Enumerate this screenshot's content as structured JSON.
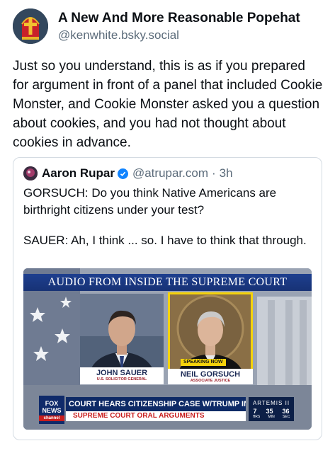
{
  "author": {
    "display_name": "A New And More Reasonable Popehat",
    "handle": "@kenwhite.bsky.social"
  },
  "post_text": "Just so you understand, this is as if you prepared for argument in front of a panel that included Cookie Monster, and Cookie Monster asked you a question about cookies, and you had not thought about cookies in advance.",
  "quoted_post": {
    "display_name": "Aaron Rupar",
    "handle": "@atrupar.com",
    "separator": "·",
    "time": "3h",
    "text_line1": "GORSUCH: Do you think Native Americans are birthright citizens under your test?",
    "text_line2": "SAUER: Ah, I think ... so. I have to think that through.",
    "media": {
      "banner": "AUDIO FROM INSIDE THE SUPREME COURT",
      "left_name": "JOHN SAUER",
      "left_title": "U.S. SOLICITOR GENERAL",
      "right_name": "NEIL GORSUCH",
      "right_title": "ASSOCIATE JUSTICE",
      "speaking_label": "SPEAKING NOW",
      "network_logo": "FOX NEWS",
      "network_sub": "channel",
      "chyron_top": "COURT HEARS CITIZENSHIP CASE W/TRUMP IN ATTENDANCE",
      "chyron_bottom": "SUPREME COURT ORAL ARGUMENTS",
      "side_label": "ARTEMIS II",
      "side_values": [
        "7",
        "35",
        "36"
      ],
      "side_units": [
        "HRS",
        "MIN",
        "SEC"
      ]
    }
  },
  "colors": {
    "verified": "#1083fe",
    "handle_gray": "#5b6b7a",
    "banner_blue": "#1e3f8f",
    "speaking_yellow": "#f4d20c",
    "chyron_red": "#c81e1e"
  }
}
